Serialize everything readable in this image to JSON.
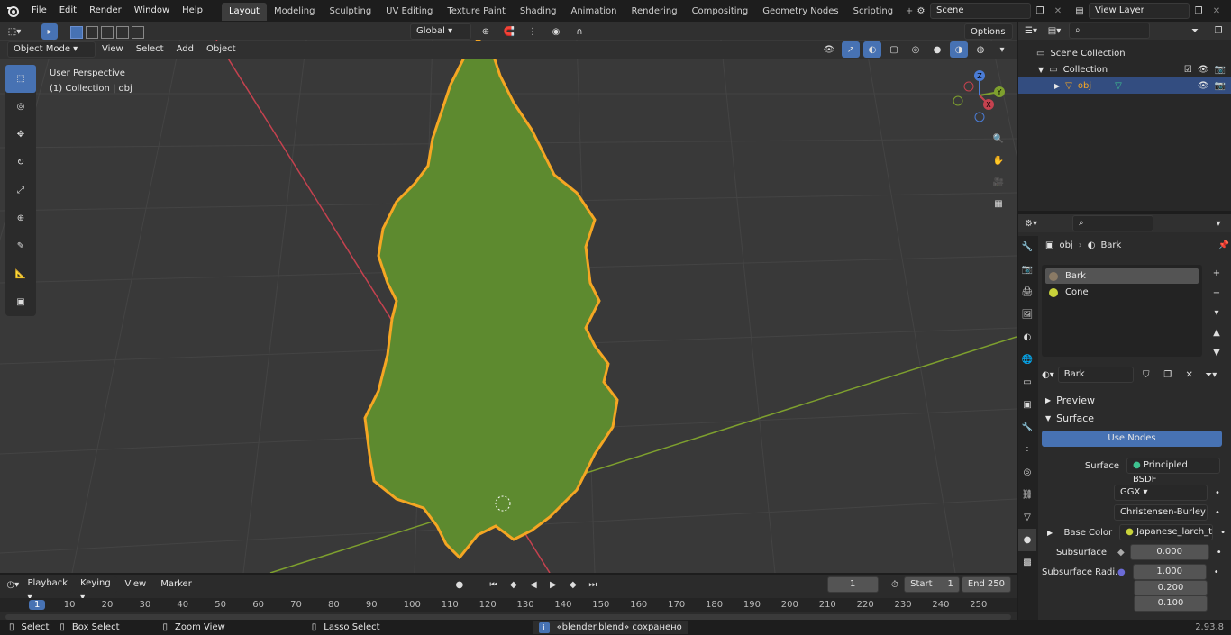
{
  "topbar": {
    "menus": [
      "File",
      "Edit",
      "Render",
      "Window",
      "Help"
    ],
    "workspaces": [
      "Layout",
      "Modeling",
      "Sculpting",
      "UV Editing",
      "Texture Paint",
      "Shading",
      "Animation",
      "Rendering",
      "Compositing",
      "Geometry Nodes",
      "Scripting"
    ],
    "active_workspace": "Layout",
    "scene": "Scene",
    "view_layer": "View Layer"
  },
  "viewport": {
    "mode": "Object Mode",
    "menus": [
      "View",
      "Select",
      "Add",
      "Object"
    ],
    "transform_orientation": "Global",
    "options_label": "Options",
    "perspective_label": "User Perspective",
    "collection_label": "(1) Collection | obj",
    "gizmo_axes": [
      "Z",
      "Y",
      "X"
    ]
  },
  "outliner": {
    "items": [
      {
        "label": "Scene Collection"
      },
      {
        "label": "Collection"
      },
      {
        "label": "obj"
      }
    ]
  },
  "properties": {
    "breadcrumb_object": "obj",
    "breadcrumb_material": "Bark",
    "material_slots": [
      "Bark",
      "Cone"
    ],
    "material_name": "Bark",
    "preview_label": "Preview",
    "surface_label": "Surface",
    "use_nodes_label": "Use Nodes",
    "surface_field_label": "Surface",
    "surface_value": "Principled BSDF",
    "distribution": "GGX",
    "subsurface_method": "Christensen-Burley",
    "base_color_label": "Base Color",
    "base_color_value": "Japanese_larch_tree...",
    "subsurface_label": "Subsurface",
    "subsurface_value": "0.000",
    "subsurface_radius_label": "Subsurface Radi...",
    "subsurface_radius": [
      "1.000",
      "0.200",
      "0.100"
    ]
  },
  "timeline": {
    "menus": [
      "Playback",
      "Keying",
      "View",
      "Marker"
    ],
    "current_frame": "1",
    "start_label": "Start",
    "start_value": "1",
    "end_label": "End",
    "end_value": "250",
    "ruler": [
      "1",
      "10",
      "20",
      "30",
      "40",
      "50",
      "60",
      "70",
      "80",
      "90",
      "100",
      "110",
      "120",
      "130",
      "140",
      "150",
      "160",
      "170",
      "180",
      "190",
      "200",
      "210",
      "220",
      "230",
      "240",
      "250"
    ]
  },
  "statusbar": {
    "select": "Select",
    "box_select": "Box Select",
    "zoom_view": "Zoom View",
    "lasso_select": "Lasso Select",
    "message": "«blender.blend» сохранено",
    "version": "2.93.8"
  },
  "colors": {
    "accent": "#4772b3",
    "selection_outline": "#f5a623",
    "tree_green": "#5d8a2f",
    "x_axis": "#c5424f",
    "y_axis": "#7ea02e"
  }
}
